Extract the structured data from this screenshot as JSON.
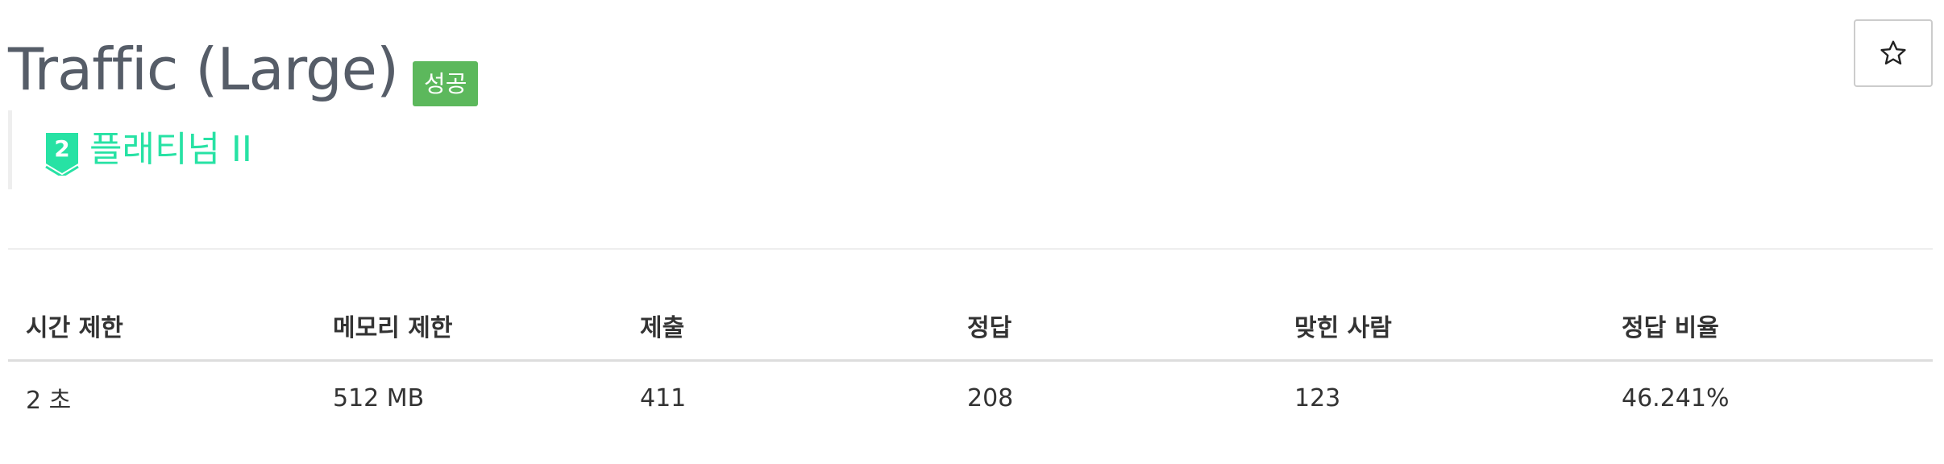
{
  "problem": {
    "title": "Traffic (Large)",
    "status_badge": "성공"
  },
  "tier": {
    "label": "플래티넘 II",
    "level_number": "2",
    "icon": "tier-shield-icon",
    "color": "#27e2a4"
  },
  "star": {
    "icon": "star-icon"
  },
  "info_table": {
    "headers": [
      "시간 제한",
      "메모리 제한",
      "제출",
      "정답",
      "맞힌 사람",
      "정답 비율"
    ],
    "rows": [
      [
        "2 초",
        "512 MB",
        "411",
        "208",
        "123",
        "46.241%"
      ]
    ]
  },
  "colors": {
    "title": "#565d68",
    "badge_success": "#5cb85c",
    "tier_accent": "#27e2a4"
  }
}
